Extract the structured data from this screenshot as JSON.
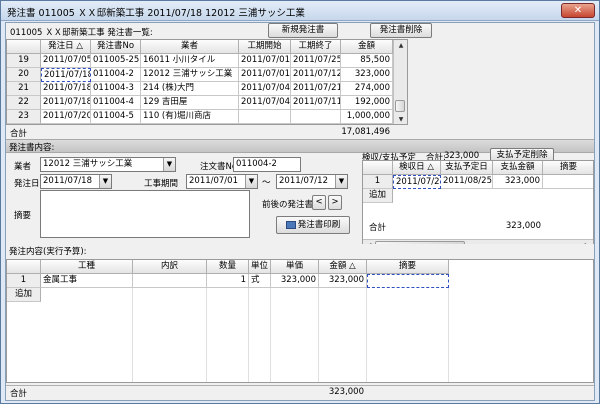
{
  "window": {
    "title": "発注書 011005 ＸＸ邸新築工事 2011/07/18 12012 三浦サッシ工業",
    "close_glyph": "✕"
  },
  "list_section": {
    "title": "011005 ＸＸ邸新築工事 発注書一覧:",
    "new_button": "新規発注書",
    "delete_button": "発注書削除",
    "columns": [
      "発注日 △",
      "発注書No",
      "業者",
      "工期開始",
      "工期終了",
      "金額"
    ],
    "rows": [
      {
        "num": "19",
        "date": "2011/07/05",
        "no": "011005-25",
        "vendor": "16011 小川タイル",
        "start": "2011/07/01",
        "end": "2011/07/25",
        "amount": "85,500"
      },
      {
        "num": "20",
        "date": "2011/07/18",
        "no": "011004-2",
        "vendor": "12012 三浦サッシ工業",
        "start": "2011/07/01",
        "end": "2011/07/12",
        "amount": "323,000"
      },
      {
        "num": "21",
        "date": "2011/07/18",
        "no": "011004-3",
        "vendor": "214 (株)大門",
        "start": "2011/07/04",
        "end": "2011/07/21",
        "amount": "274,000"
      },
      {
        "num": "22",
        "date": "2011/07/18",
        "no": "011004-4",
        "vendor": "129 吉田屋",
        "start": "2011/07/04",
        "end": "2011/07/11",
        "amount": "192,000"
      },
      {
        "num": "23",
        "date": "2011/07/20",
        "no": "011004-5",
        "vendor": "110 (有)堀川商店",
        "start": "",
        "end": "",
        "amount": "1,000,000"
      }
    ],
    "total_label": "合計",
    "total_amount": "17,081,496"
  },
  "detail_section": {
    "title": "発注書内容:",
    "vendor_label": "業者",
    "vendor_value": "12012 三浦サッシ工業",
    "order_no_label": "注文書No",
    "order_no_value": "011004-2",
    "order_date_label": "発注日",
    "order_date_value": "2011/07/18",
    "period_label": "工事期間",
    "period_start": "2011/07/01",
    "period_sep": "～",
    "period_end": "2011/07/12",
    "memo_label": "摘要",
    "memo_value": "",
    "nav_label": "前後の発注書",
    "prev_button": "<",
    "next_button": ">",
    "print_button": "発注書印刷",
    "payment": {
      "title": "検収/支払予定",
      "total_label": "合計:",
      "total_value": "323,000",
      "delete_button": "支払予定削除",
      "columns": [
        "検収日 △",
        "支払予定日",
        "支払金額",
        "摘要"
      ],
      "rows": [
        {
          "num": "1",
          "accept": "2011/07/25",
          "pay": "2011/08/25",
          "amount": "323,000",
          "memo": ""
        }
      ],
      "add_label": "追加",
      "sum_label": "合計",
      "sum_value": "323,000"
    }
  },
  "budget_section": {
    "title": "発注内容(実行予算):",
    "columns": [
      "工種",
      "内訳",
      "数量",
      "単位",
      "単価",
      "金額 △",
      "摘要"
    ],
    "rows": [
      {
        "num": "1",
        "kind": "金属工事",
        "breakdown": "",
        "qty": "1",
        "unit": "式",
        "price": "323,000",
        "amount": "323,000",
        "memo": ""
      }
    ],
    "add_label": "追加",
    "total_label": "合計",
    "total_value": "323,000"
  }
}
